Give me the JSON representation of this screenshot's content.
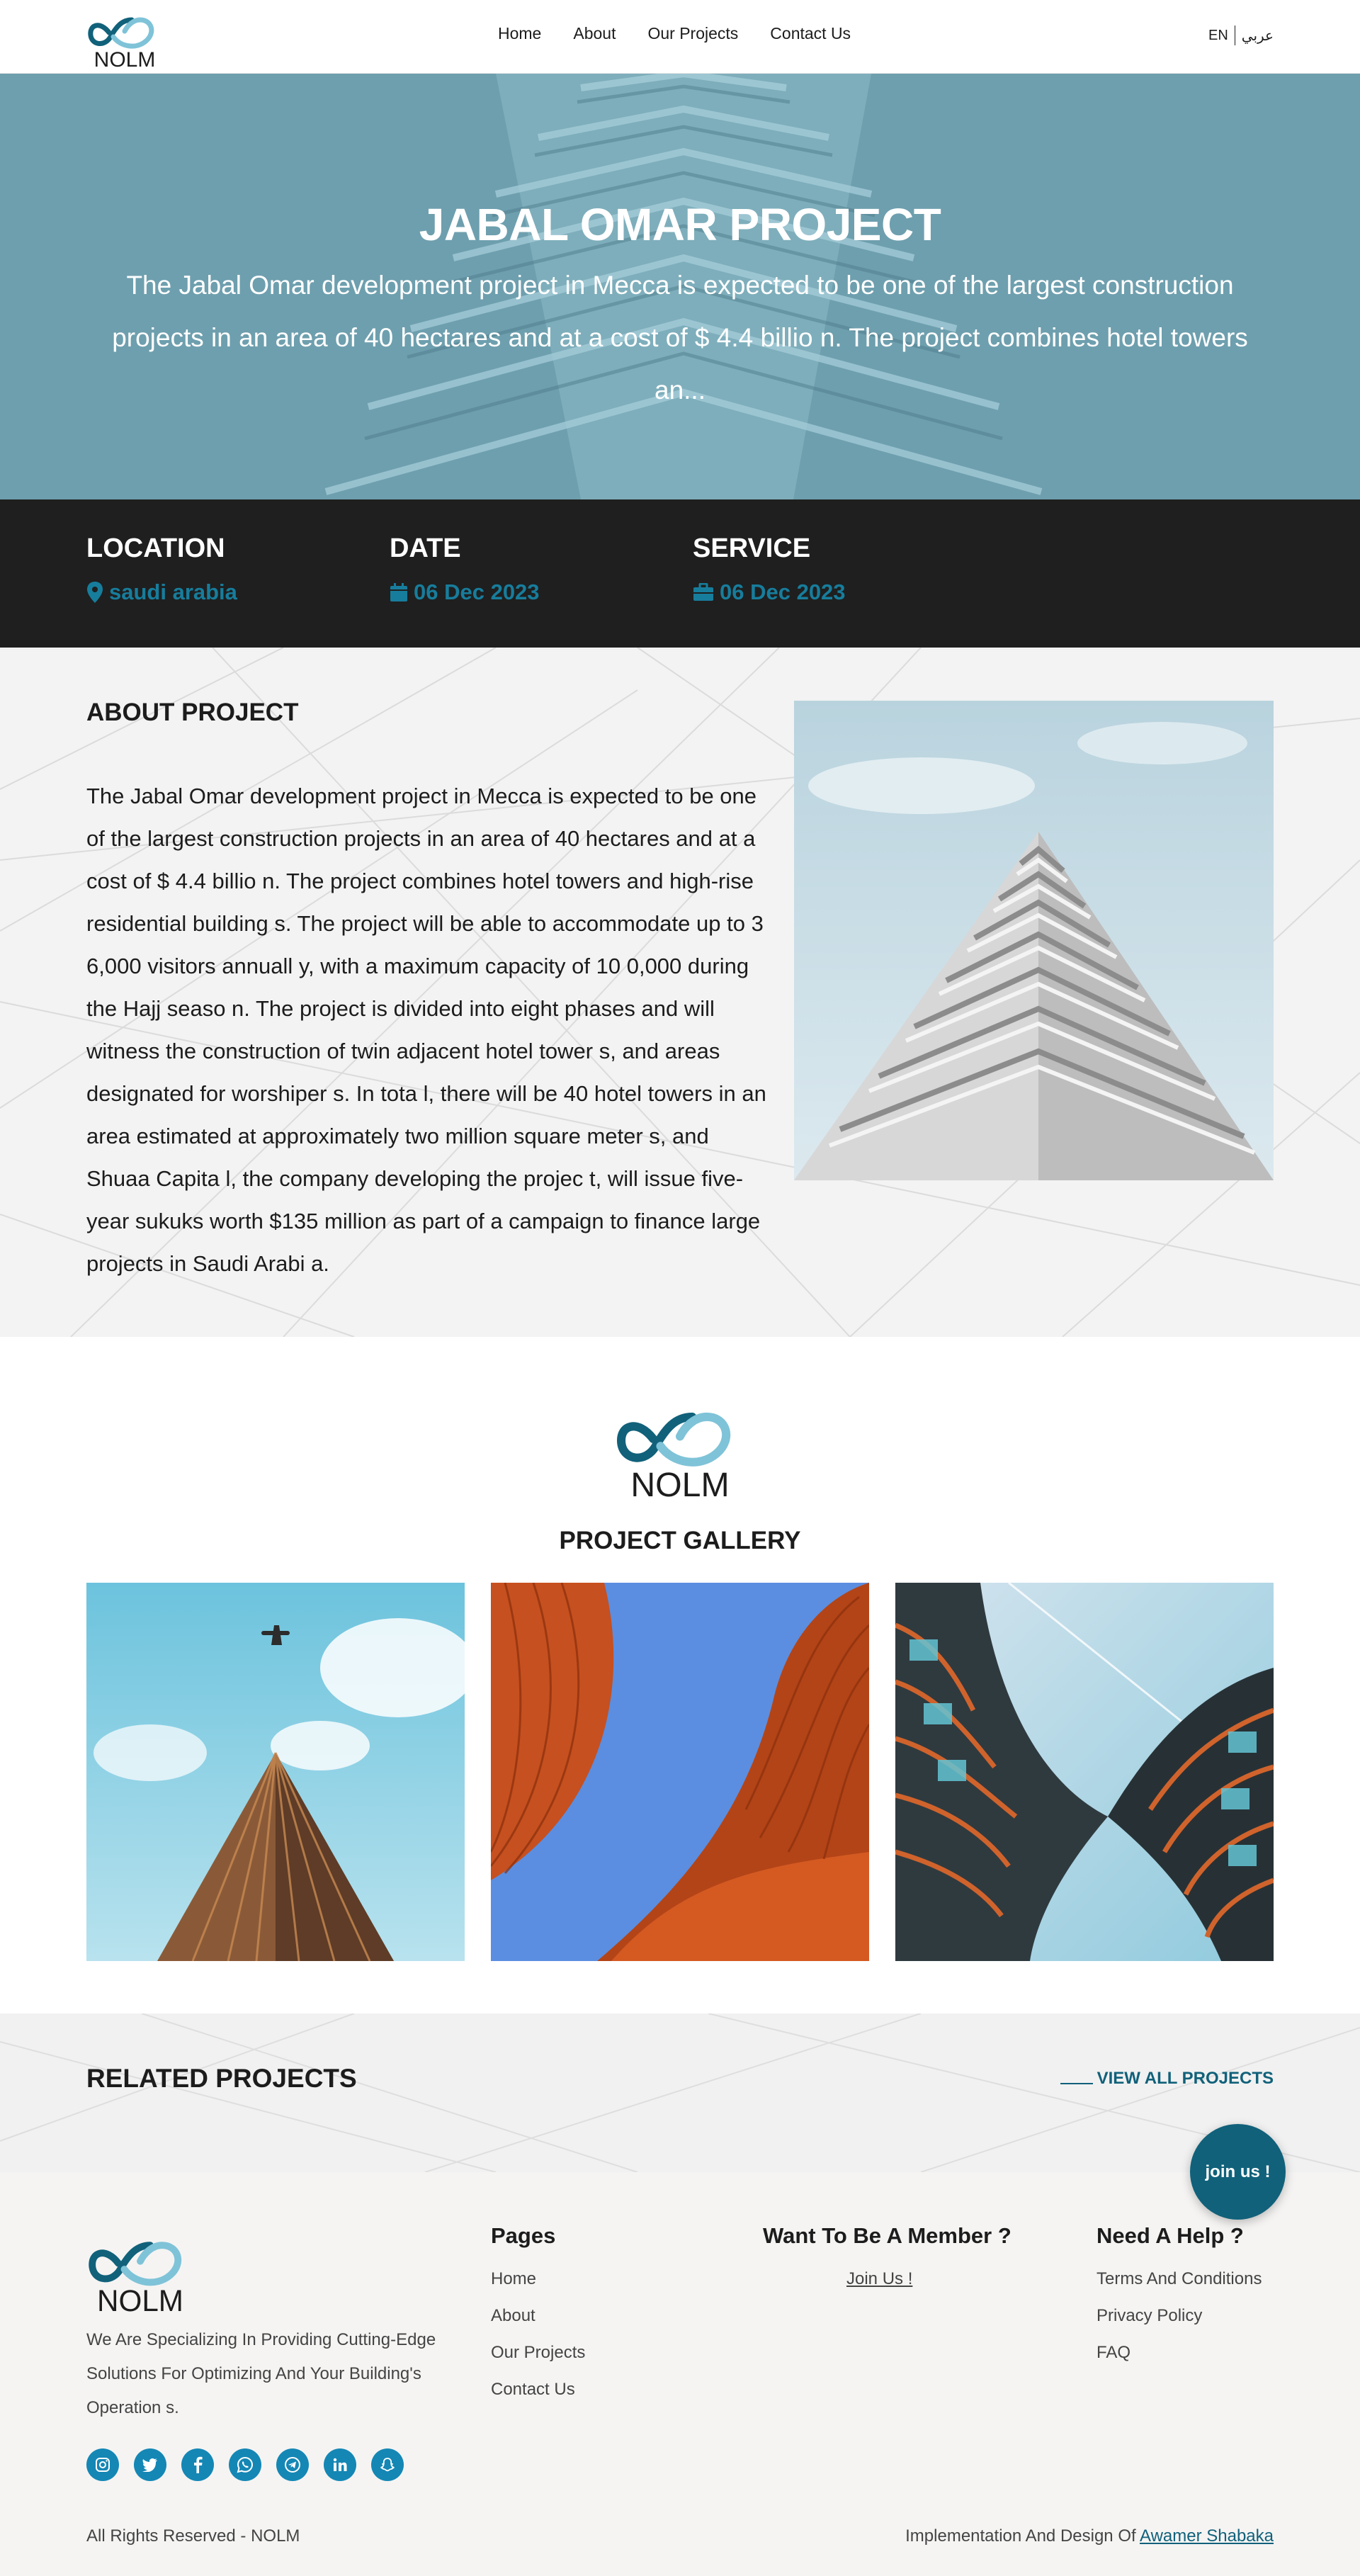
{
  "nav": {
    "logo_text": "NOLM",
    "links": [
      "Home",
      "About",
      "Our Projects",
      "Contact Us"
    ],
    "lang_en": "EN",
    "lang_ar": "عربي"
  },
  "hero": {
    "title": "JABAL OMAR PROJECT",
    "text": "The Jabal Omar development project in Mecca is expected to be one of the largest construction projects in an area of 40 hectares and at a cost of $ 4.4 billio n. The project combines hotel towers an..."
  },
  "info": {
    "location_label": "LOCATION",
    "location_value": "saudi arabia",
    "date_label": "DATE",
    "date_value": "06 Dec 2023",
    "service_label": "SERVICE",
    "service_value": "06 Dec 2023"
  },
  "about": {
    "title": "ABOUT PROJECT",
    "text": "The Jabal Omar development project in Mecca is expected to be one of the largest construction projects in an area of 40 hectares and at a cost of $ 4.4 billio n. The project combines hotel towers and high-rise residential building s. The project will be able to accommodate up to 3 6,000 visitors annuall y, with a maximum capacity of 10 0,000 during the Hajj seaso n. The project is divided into eight phases and will witness the construction of twin adjacent hotel tower s, and areas designated for worshiper s. In tota l, there will be 40 hotel towers in an area estimated at approximately two million square meter s, and Shuaa Capita l, the company developing the projec t, will issue five-year sukuks worth $135 million as part of a campaign to finance large projects in Saudi Arabi a."
  },
  "gallery": {
    "logo_text": "NOLM",
    "title": "PROJECT GALLERY"
  },
  "related": {
    "title": "RELATED PROJECTS",
    "view_all": "VIEW ALL PROJECTS"
  },
  "join_button": "join us !",
  "footer": {
    "logo_text": "NOLM",
    "description": "We Are Specializing In Providing Cutting-Edge Solutions For Optimizing And Your Building's Operation s.",
    "pages_title": "Pages",
    "pages": [
      "Home",
      "About",
      "Our Projects",
      "Contact Us"
    ],
    "member_title": "Want To Be A Member ?",
    "member_link": "Join Us !",
    "help_title": "Need A Help ?",
    "help": [
      "Terms And Conditions",
      "Privacy Policy",
      "FAQ"
    ],
    "socials": [
      "instagram-icon",
      "twitter-icon",
      "facebook-icon",
      "whatsapp-icon",
      "telegram-icon",
      "linkedin-icon",
      "snapchat-icon"
    ],
    "copyright": "All Rights Reserved - NOLM",
    "credit_prefix": "Implementation And Design Of",
    "credit_link": "Awamer Shabaka"
  },
  "colors": {
    "brand_dark": "#11617a",
    "brand_light": "#7fc3d8",
    "info_bg": "#1f1f1f",
    "info_accent": "#177d9c",
    "social_bg": "#1487b5"
  }
}
